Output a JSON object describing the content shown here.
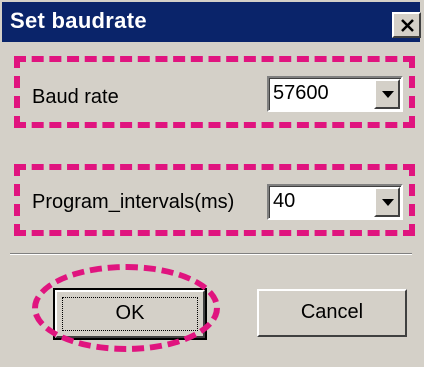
{
  "window": {
    "title": "Set baudrate",
    "close_icon": "close-x-icon"
  },
  "fields": {
    "baud_rate": {
      "label": "Baud rate",
      "value": "57600"
    },
    "program_intervals": {
      "label": "Program_intervals(ms)",
      "value": "40"
    }
  },
  "buttons": {
    "ok": "OK",
    "cancel": "Cancel"
  },
  "colors": {
    "title_bar": "#0a246a",
    "dialog_bg": "#d4d0c8",
    "highlight": "#e0147f"
  }
}
